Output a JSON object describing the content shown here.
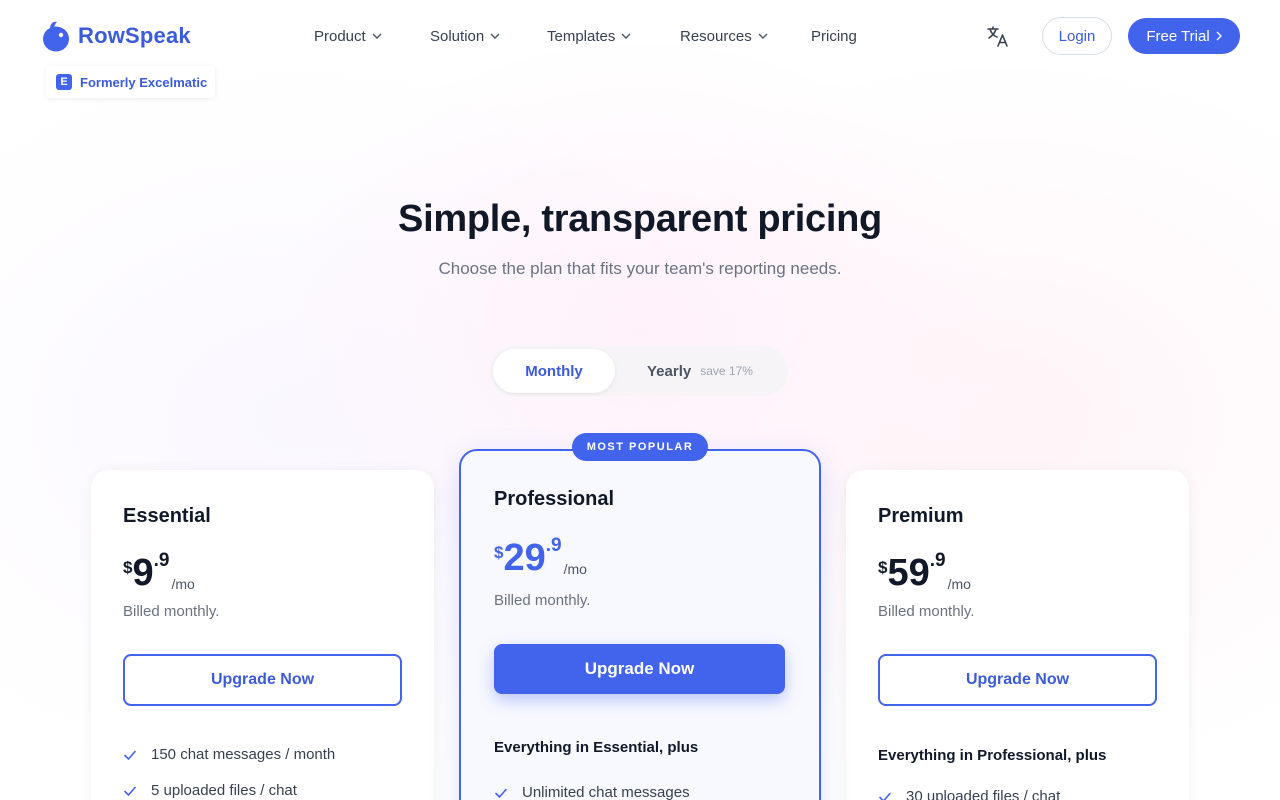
{
  "brand": {
    "name": "RowSpeak",
    "formerly_label": "Formerly Excelmatic",
    "formerly_icon_letter": "E",
    "accent_color": "#4263eb"
  },
  "nav": {
    "items": [
      {
        "label": "Product",
        "dropdown": true
      },
      {
        "label": "Solution",
        "dropdown": true
      },
      {
        "label": "Templates",
        "dropdown": true
      },
      {
        "label": "Resources",
        "dropdown": true
      },
      {
        "label": "Pricing",
        "dropdown": false
      }
    ],
    "language_icon": "translate-icon",
    "login_label": "Login",
    "trial_label": "Free Trial"
  },
  "hero": {
    "title": "Simple, transparent pricing",
    "subtitle": "Choose the plan that fits your team's reporting needs."
  },
  "billing_toggle": {
    "selected": "Monthly",
    "monthly_label": "Monthly",
    "yearly_label": "Yearly",
    "yearly_note": "save 17%"
  },
  "plans": [
    {
      "name": "Essential",
      "currency": "$",
      "price": "9",
      "decimals": ".9",
      "period": "/mo",
      "billed": "Billed monthly.",
      "cta": "Upgrade Now",
      "features_heading": "",
      "features": [
        "150 chat messages / month",
        "5 uploaded files / chat"
      ]
    },
    {
      "name": "Professional",
      "badge": "MOST POPULAR",
      "currency": "$",
      "price": "29",
      "decimals": ".9",
      "period": "/mo",
      "billed": "Billed monthly.",
      "cta": "Upgrade Now",
      "features_heading": "Everything in Essential, plus",
      "features": [
        "Unlimited chat messages"
      ]
    },
    {
      "name": "Premium",
      "currency": "$",
      "price": "59",
      "decimals": ".9",
      "period": "/mo",
      "billed": "Billed monthly.",
      "cta": "Upgrade Now",
      "features_heading": "Everything in Professional, plus",
      "features": [
        "30 uploaded files / chat"
      ]
    }
  ]
}
